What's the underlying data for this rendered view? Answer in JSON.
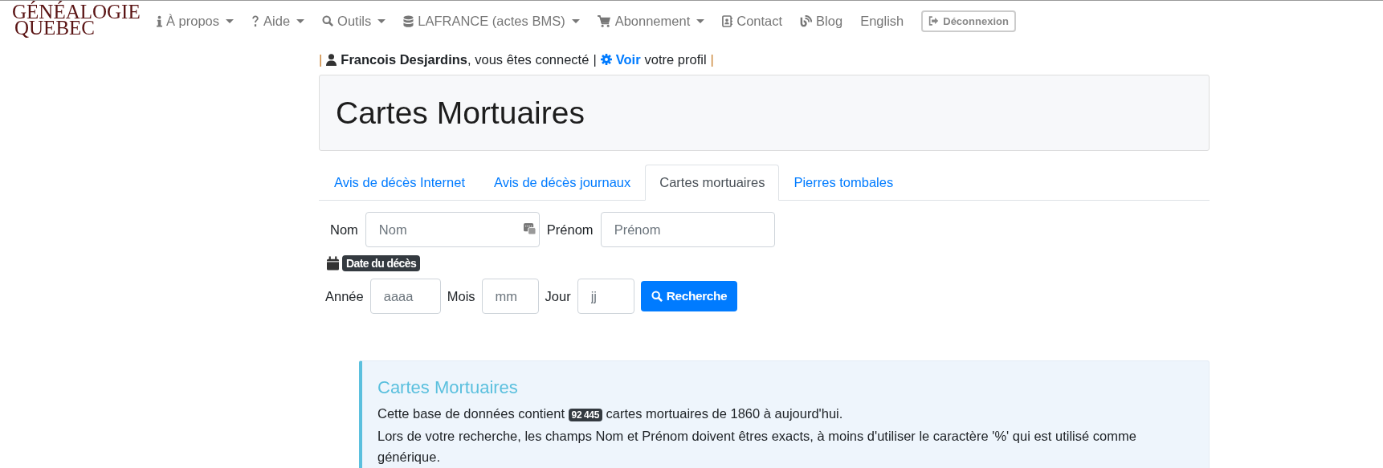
{
  "logo": {
    "line_1": "GÉNÉALOGIE",
    "line_2": "QUEBEC"
  },
  "nav": [
    {
      "label": "À propos",
      "kind": "dropdown"
    },
    {
      "label": "Aide",
      "kind": "dropdown"
    },
    {
      "label": "Outils",
      "kind": "dropdown"
    },
    {
      "label": "LAFRANCE (actes BMS)",
      "kind": "dropdown"
    },
    {
      "label": "Abonnement",
      "kind": "dropdown"
    },
    {
      "label": "Contact",
      "kind": "link"
    },
    {
      "label": "Blog",
      "kind": "link"
    },
    {
      "label": "English",
      "kind": "link"
    },
    {
      "label": "Déconnexion",
      "kind": "button"
    }
  ],
  "user_bar": {
    "separator": "|",
    "greeting": "**Francois Desjardins**, vous êtes connecté",
    "link": "Voir",
    "link_suffix": "votre profil"
  },
  "page_title": "Cartes Mortuaires",
  "tabs": [
    {
      "label": "Avis de décès Internet",
      "selected": false
    },
    {
      "label": "Avis de décès journaux",
      "selected": false
    },
    {
      "label": "Cartes mortuaires",
      "selected": true
    },
    {
      "label": "Pierres tombales",
      "selected": false
    }
  ],
  "name_fields": [
    {
      "label": "Nom",
      "placeholder": "Nom"
    },
    {
      "label": "Prénom",
      "placeholder": "Prénom"
    }
  ],
  "date_badge": "Date du décès",
  "date_fields": [
    {
      "label": "Année",
      "placeholder": "aaaa"
    },
    {
      "label": "Mois",
      "placeholder": "mm"
    },
    {
      "label": "Jour",
      "placeholder": "jj"
    }
  ],
  "search_button": "Recherche",
  "info": {
    "title": "Cartes Mortuaires",
    "before_count": "Cette base de données contient",
    "count": "92 445",
    "after_count": "cartes mortuaires de 1860 à aujourd'hui.",
    "note": "Lors de votre recherche, les champs Nom et Prénom doivent êtres exacts, à moins d'utiliser le caractère '%' qui est utilisé comme générique."
  }
}
